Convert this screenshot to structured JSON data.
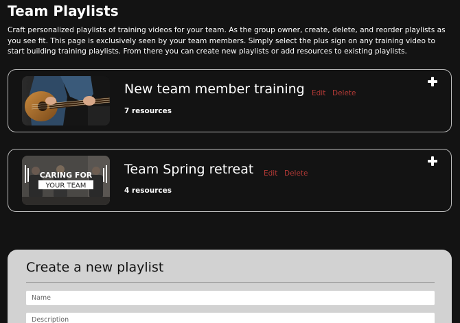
{
  "header": {
    "title": "Team Playlists",
    "description": "Craft personalized playlists of training videos for your team. As the group owner, create, delete, and reorder playlists as you see fit. This page is exclusively seen by your team members. Simply select the plus sign on any training video to start building training playlists. From there you can create new playlists or add resources to existing playlists."
  },
  "playlists": [
    {
      "title": "New team member training",
      "edit_label": "Edit",
      "delete_label": "Delete",
      "count": "7 resources",
      "thumbnail_icon": "guitar-video-thumbnail"
    },
    {
      "title": "Team Spring retreat",
      "edit_label": "Edit",
      "delete_label": "Delete",
      "count": "4 resources",
      "thumbnail_icon": "caring-for-your-team-video-thumbnail",
      "thumbnail_text_line1": "CARING FOR",
      "thumbnail_text_line2": "YOUR TEAM"
    }
  ],
  "create": {
    "title": "Create a new playlist",
    "name_placeholder": "Name",
    "description_placeholder": "Description"
  },
  "colors": {
    "background": "#131313",
    "link": "#b33a36",
    "panel": "#d2d2d2"
  }
}
